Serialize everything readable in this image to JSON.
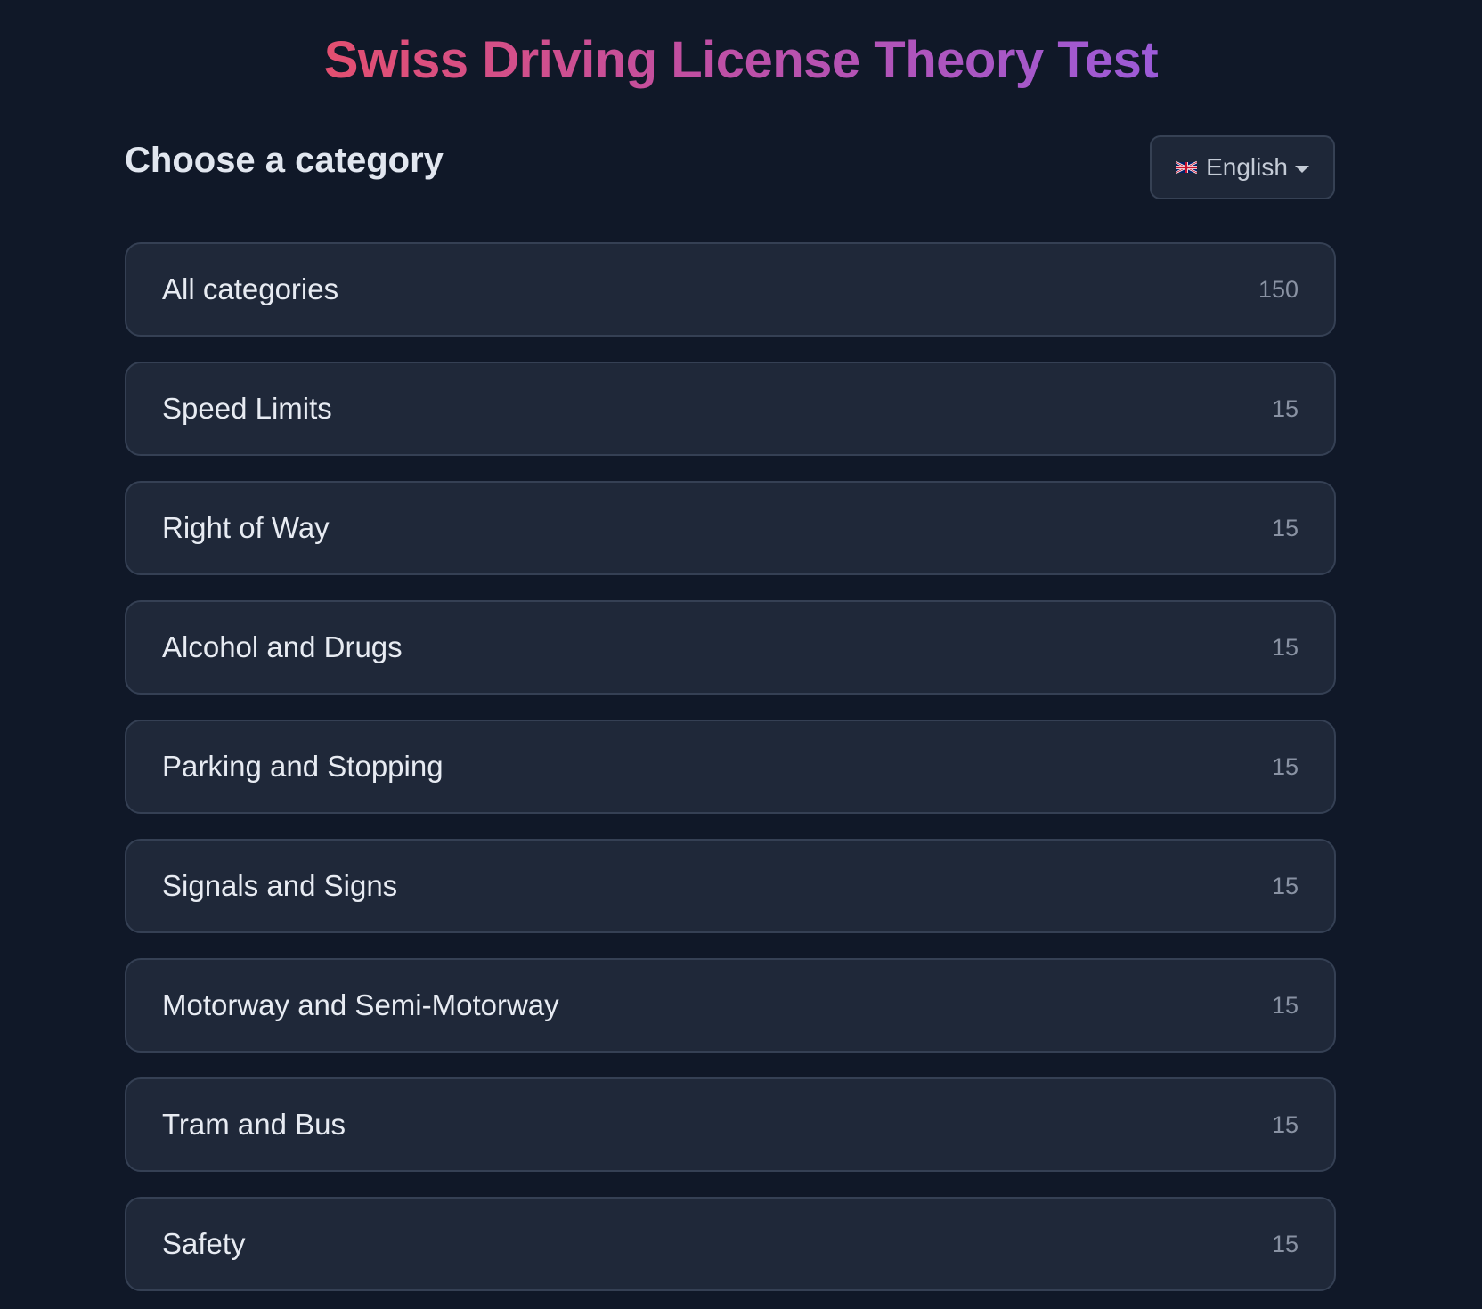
{
  "header": {
    "title": "Swiss Driving License Theory Test"
  },
  "section": {
    "heading": "Choose a category"
  },
  "language": {
    "flag_icon": "uk-flag-icon",
    "label": "English",
    "dropdown_icon": "chevron-down-icon"
  },
  "colors": {
    "background": "#101828",
    "card": "#1f2839",
    "title_gradient_start": "#e44f70",
    "title_gradient_end": "#9c5bd8"
  },
  "categories": [
    {
      "label": "All categories",
      "count": "150"
    },
    {
      "label": "Speed Limits",
      "count": "15"
    },
    {
      "label": "Right of Way",
      "count": "15"
    },
    {
      "label": "Alcohol and Drugs",
      "count": "15"
    },
    {
      "label": "Parking and Stopping",
      "count": "15"
    },
    {
      "label": "Signals and Signs",
      "count": "15"
    },
    {
      "label": "Motorway and Semi-Motorway",
      "count": "15"
    },
    {
      "label": "Tram and Bus",
      "count": "15"
    },
    {
      "label": "Safety",
      "count": "15"
    }
  ]
}
